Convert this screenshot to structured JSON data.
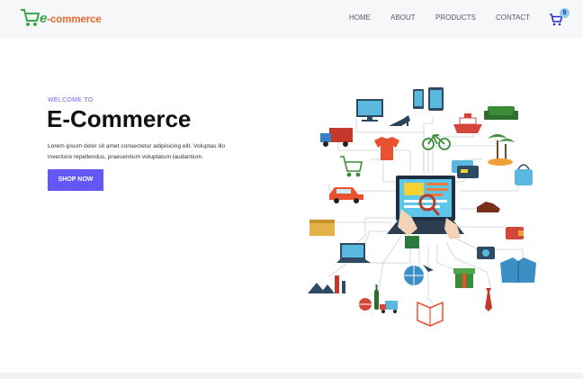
{
  "brand": {
    "logo_letter": "e",
    "logo_rest": "-commerce"
  },
  "nav": {
    "items": [
      "HOME",
      "ABOUT",
      "PRODUCTS",
      "CONTACT"
    ]
  },
  "cart": {
    "count": "5"
  },
  "hero": {
    "welcome": "WELCOME TO",
    "title": "E-Commerce",
    "description_line1": "Lorem ipsum dolor sit amet consectetur adipisicing elit. Voluptas illo",
    "description_line2": "inventore repellendus, praesentium voluptatum laudantium.",
    "button": "SHOP NOW"
  },
  "colors": {
    "accent": "#6357f5",
    "logo_orange": "#e8692a",
    "logo_green": "#3da648",
    "nav_text": "#55596a"
  },
  "illustration": {
    "icons": [
      "monitor-icon",
      "tablet-icon",
      "phone-icon",
      "heel-icon",
      "ship-icon",
      "sofa-icon",
      "truck-icon",
      "tshirt-icon",
      "bicycle-icon",
      "palm-island-icon",
      "cart-icon",
      "credit-card-icon",
      "handbag-icon",
      "car-icon",
      "laptop-search-icon",
      "shoe-icon",
      "box-icon",
      "wallet-icon",
      "laptop-icon",
      "camera-icon",
      "jacket-icon",
      "globe-plane-icon",
      "gift-icon",
      "pyramids-icon",
      "tower-icon",
      "wine-icon",
      "ball-icon",
      "truck-small-icon",
      "book-icon",
      "tie-icon",
      "hand-icon"
    ]
  }
}
